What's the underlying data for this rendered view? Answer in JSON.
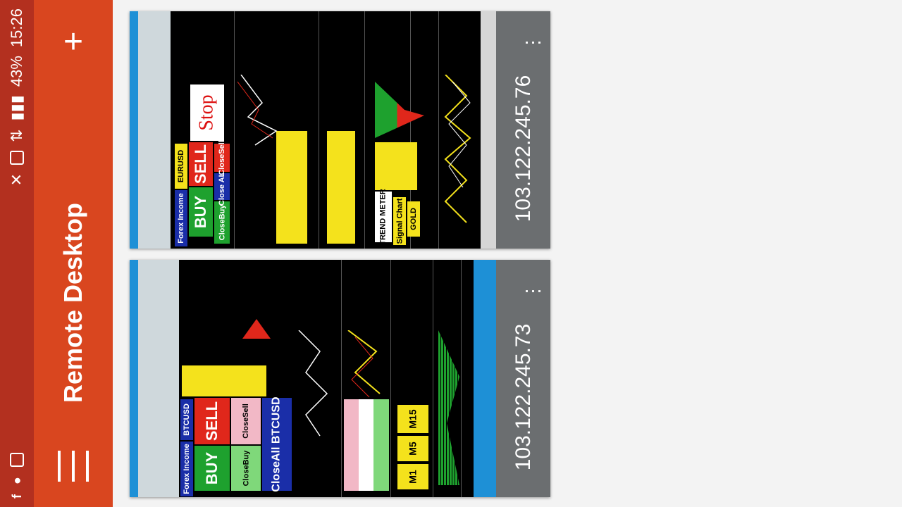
{
  "status_bar": {
    "time": "15:26",
    "battery": "43%",
    "icons": [
      "facebook-icon",
      "android-icon",
      "cast-icon",
      "mute-icon",
      "sim-icon",
      "data-icon",
      "signal-icon"
    ]
  },
  "app_bar": {
    "title": "Remote Desktop",
    "add_icon": "plus-icon",
    "menu_icon": "hamburger-menu-icon",
    "color": "#d9461f"
  },
  "connections": [
    {
      "ip": "103.122.245.76",
      "more_icon": "more-options-icon",
      "preview": {
        "panel_title": "Forex Income",
        "symbol": "EURUSD",
        "buy": "BUY",
        "sell": "SELL",
        "close_buy": "CloseBuy",
        "close_all": "Close ALL",
        "close_sell": "CloseSell",
        "stop": "Stop",
        "signal": "Signal Chart",
        "gold": "GOLD",
        "trend": "TREND METER"
      }
    },
    {
      "ip": "103.122.245.73",
      "more_icon": "more-options-icon",
      "preview": {
        "panel_title": "Forex Income",
        "symbol": "BTCUSD",
        "buy": "BUY",
        "sell": "SELL",
        "close_buy": "CloseBuy",
        "close_sell": "CloseSell",
        "close_all": "CloseAll BTCUSD",
        "tf_m1": "M1",
        "tf_m5": "M5",
        "tf_m15": "M15"
      }
    }
  ]
}
